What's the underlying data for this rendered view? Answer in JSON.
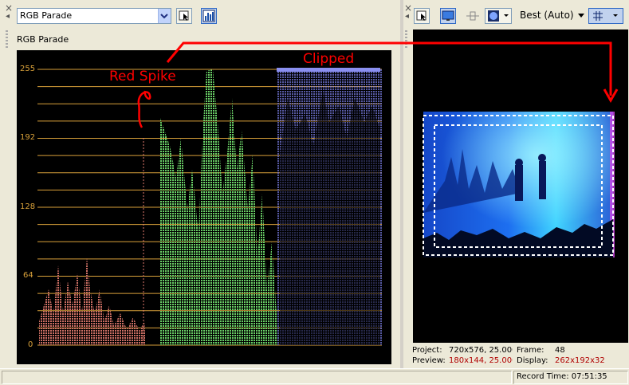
{
  "left_panel": {
    "scope_select_value": "RGB Parade",
    "title": "RGB Parade",
    "close_glyph": "×",
    "pin_glyph": "◂"
  },
  "right_panel": {
    "quality_value": "Best (Auto)",
    "close_glyph": "×",
    "pin_glyph": "◂"
  },
  "scope": {
    "ticks": [
      "255",
      "192",
      "128",
      "64",
      "0"
    ],
    "colors": {
      "red": "#e07a6e",
      "green": "#6fd86b",
      "blue": "#7b7fe8",
      "grid": "#d9a13a"
    }
  },
  "annotations": {
    "red_spike": "Red Spike",
    "clipped": "Clipped",
    "color": "#ff0000"
  },
  "project_info": {
    "project_label": "Project:",
    "project_value": "720x576, 25.000",
    "preview_label": "Preview:",
    "preview_value": "180x144, 25.000",
    "frame_label": "Frame:",
    "frame_value": "48",
    "display_label": "Display:",
    "display_value": "262x192x32"
  },
  "status": {
    "record_time": "Record Time: 07:51:35"
  }
}
